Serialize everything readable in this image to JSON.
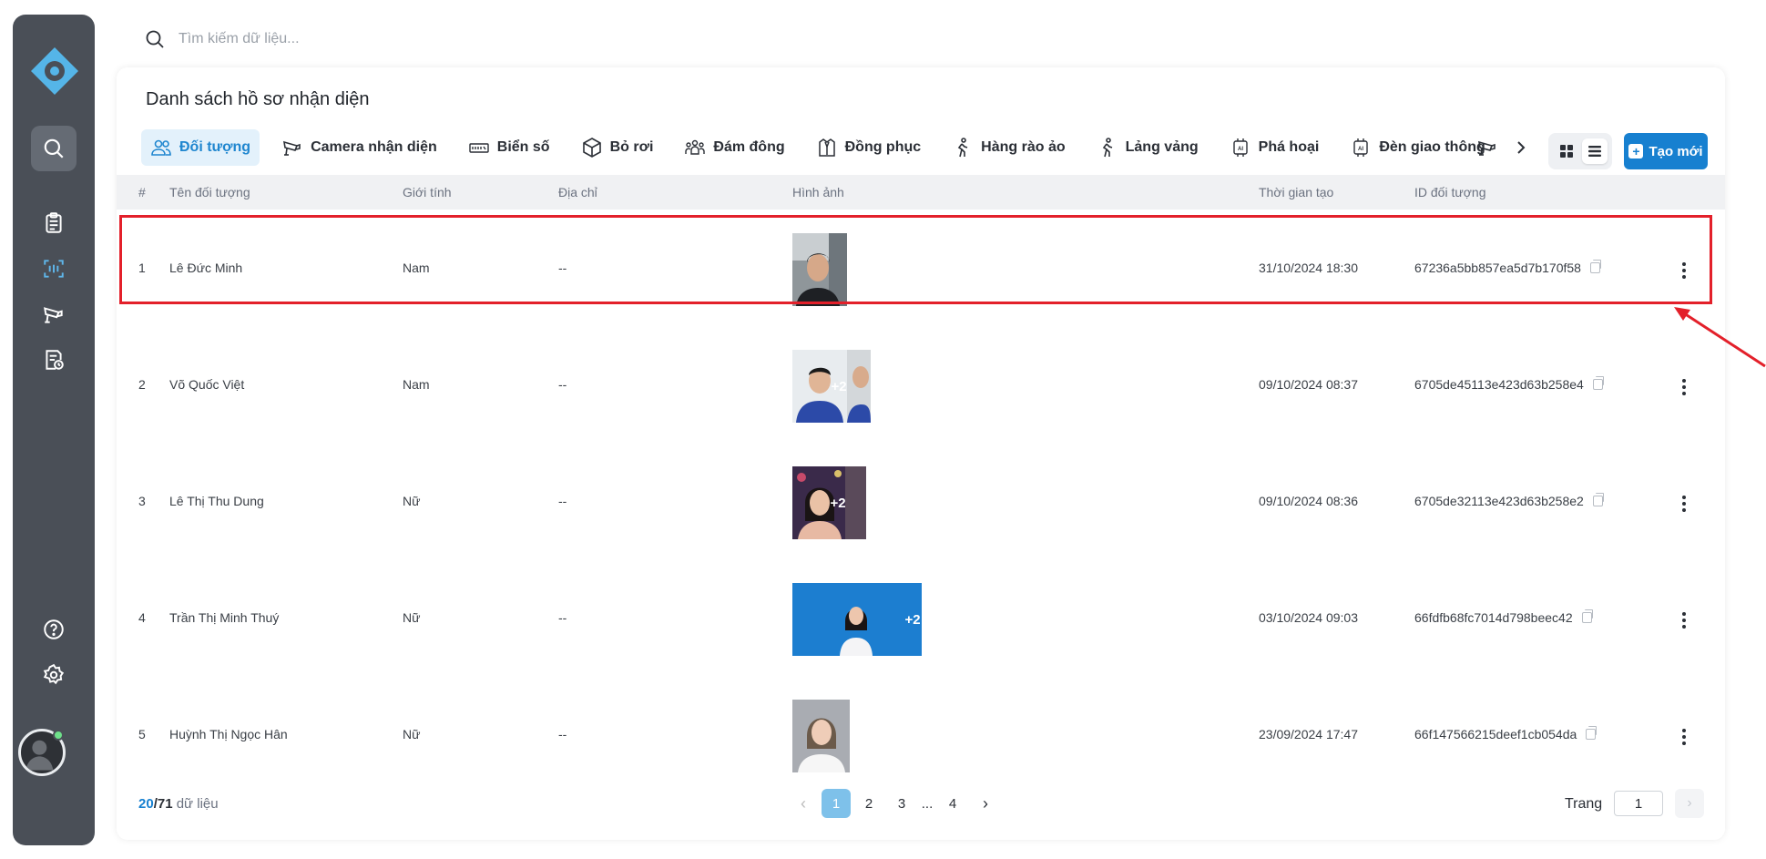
{
  "search": {
    "placeholder": "Tìm kiếm dữ liệu..."
  },
  "page": {
    "title": "Danh sách hồ sơ nhận diện"
  },
  "tabs": [
    {
      "label": "Đối tượng",
      "icon": "users-icon",
      "active": true
    },
    {
      "label": "Camera nhận diện",
      "icon": "camera-icon"
    },
    {
      "label": "Biển số",
      "icon": "license-plate-icon"
    },
    {
      "label": "Bỏ rơi",
      "icon": "box-icon"
    },
    {
      "label": "Đám đông",
      "icon": "crowd-icon"
    },
    {
      "label": "Đồng phục",
      "icon": "uniform-icon"
    },
    {
      "label": "Hàng rào ảo",
      "icon": "walking-icon"
    },
    {
      "label": "Lảng vảng",
      "icon": "walking-icon"
    },
    {
      "label": "Phá hoại",
      "icon": "ai-chip-icon"
    },
    {
      "label": "Đèn giao thông",
      "icon": "ai-chip-icon"
    }
  ],
  "toolbar": {
    "create_label": "Tạo mới"
  },
  "table": {
    "headers": [
      "#",
      "Tên đối tượng",
      "Giới tính",
      "Địa chỉ",
      "Hình ảnh",
      "Thời gian tạo",
      "ID đối tượng"
    ],
    "rows": [
      {
        "index": "1",
        "name": "Lê Đức Minh",
        "gender": "Nam",
        "address": "--",
        "extra": "",
        "created": "31/10/2024 18:30",
        "id": "67236a5bb857ea5d7b170f58"
      },
      {
        "index": "2",
        "name": "Võ Quốc Việt",
        "gender": "Nam",
        "address": "--",
        "extra": "+2",
        "created": "09/10/2024 08:37",
        "id": "6705de45113e423d63b258e4"
      },
      {
        "index": "3",
        "name": "Lê Thị Thu Dung",
        "gender": "Nữ",
        "address": "--",
        "extra": "+2",
        "created": "09/10/2024 08:36",
        "id": "6705de32113e423d63b258e2"
      },
      {
        "index": "4",
        "name": "Trần Thị Minh Thuý",
        "gender": "Nữ",
        "address": "--",
        "extra": "+2",
        "created": "03/10/2024 09:03",
        "id": "66fdfb68fc7014d798beec42"
      },
      {
        "index": "5",
        "name": "Huỳnh Thị Ngọc Hân",
        "gender": "Nữ",
        "address": "--",
        "extra": "",
        "created": "23/09/2024 17:47",
        "id": "66f147566215deef1cb054da"
      }
    ]
  },
  "footer": {
    "shown": "20",
    "total": "/71",
    "suffix": " dữ liệu",
    "pages": [
      "1",
      "2",
      "3",
      "...",
      "4"
    ],
    "page_label": "Trang",
    "page_value": "1"
  },
  "colors": {
    "accent": "#1780d0",
    "sidebar": "#4a4f57",
    "highlight": "#e3202a"
  }
}
